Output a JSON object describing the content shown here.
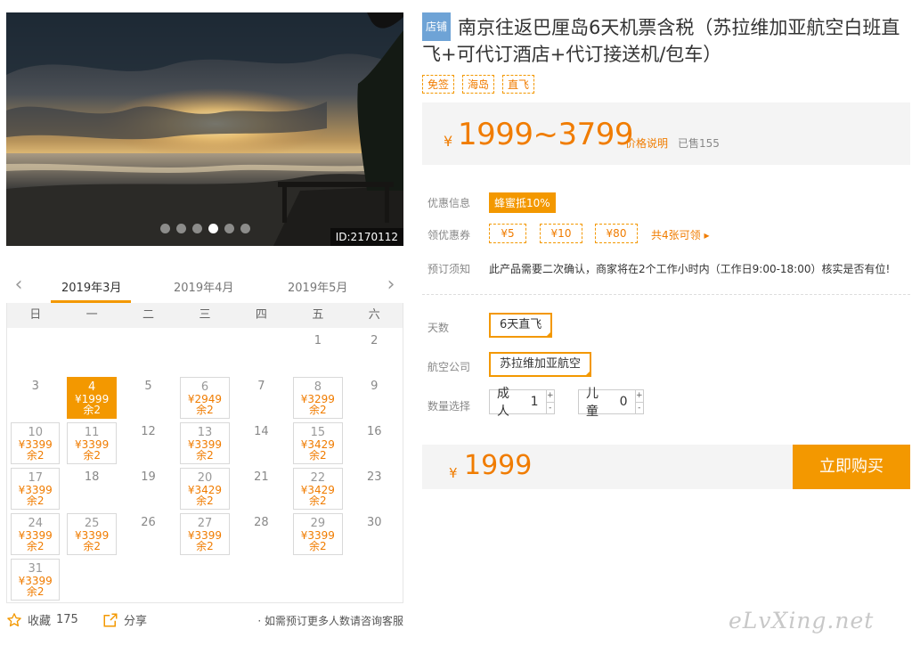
{
  "gallery": {
    "photo_id": "ID:2170112",
    "dot_count": 6,
    "active_dot": 3
  },
  "calendar": {
    "months": [
      "2019年3月",
      "2019年4月",
      "2019年5月"
    ],
    "active_month": 0,
    "weekdays": [
      "日",
      "一",
      "二",
      "三",
      "四",
      "五",
      "六"
    ],
    "days": [
      {
        "d": ""
      },
      {
        "d": ""
      },
      {
        "d": ""
      },
      {
        "d": ""
      },
      {
        "d": ""
      },
      {
        "d": "1"
      },
      {
        "d": "2"
      },
      {
        "d": "3"
      },
      {
        "d": "4",
        "price": "¥1999",
        "left": "余2",
        "selected": true
      },
      {
        "d": "5"
      },
      {
        "d": "6",
        "price": "¥2949",
        "left": "余2"
      },
      {
        "d": "7"
      },
      {
        "d": "8",
        "price": "¥3299",
        "left": "余2"
      },
      {
        "d": "9"
      },
      {
        "d": "10",
        "price": "¥3399",
        "left": "余2"
      },
      {
        "d": "11",
        "price": "¥3399",
        "left": "余2"
      },
      {
        "d": "12"
      },
      {
        "d": "13",
        "price": "¥3399",
        "left": "余2"
      },
      {
        "d": "14"
      },
      {
        "d": "15",
        "price": "¥3429",
        "left": "余2"
      },
      {
        "d": "16"
      },
      {
        "d": "17",
        "price": "¥3399",
        "left": "余2"
      },
      {
        "d": "18"
      },
      {
        "d": "19"
      },
      {
        "d": "20",
        "price": "¥3429",
        "left": "余2"
      },
      {
        "d": "21"
      },
      {
        "d": "22",
        "price": "¥3429",
        "left": "余2"
      },
      {
        "d": "23"
      },
      {
        "d": "24",
        "price": "¥3399",
        "left": "余2"
      },
      {
        "d": "25",
        "price": "¥3399",
        "left": "余2"
      },
      {
        "d": "26"
      },
      {
        "d": "27",
        "price": "¥3399",
        "left": "余2"
      },
      {
        "d": "28"
      },
      {
        "d": "29",
        "price": "¥3399",
        "left": "余2"
      },
      {
        "d": "30"
      },
      {
        "d": "31",
        "price": "¥3399",
        "left": "余2"
      }
    ]
  },
  "actions": {
    "fav_label": "收藏",
    "fav_count": "175",
    "share_label": "分享",
    "consult_text": "· 如需预订更多人数请咨询客服"
  },
  "product": {
    "shop_tag": "店铺",
    "title": "南京往返巴厘岛6天机票含税（苏拉维加亚航空白班直飞+可代订酒店+代订接送机/包车）",
    "tags": [
      "免签",
      "海岛",
      "直飞"
    ],
    "currency": "¥",
    "price_range": "1999~3799",
    "price_explain": "价格说明",
    "sold": "已售155"
  },
  "promo": {
    "discount_label": "优惠信息",
    "discount_badge": "蜂蜜抵10%",
    "coupon_label": "领优惠券",
    "coupons": [
      "¥5",
      "¥10",
      "¥80"
    ],
    "coupon_link": "共4张可领 ▸",
    "notice_label": "预订须知",
    "notice_text": "此产品需要二次确认，商家将在2个工作小时内（工作日9:00-18:00）核实是否有位!"
  },
  "options": {
    "days_label": "天数",
    "days_value": "6天直飞",
    "airline_label": "航空公司",
    "airline_value": "苏拉维加亚航空",
    "qty_label": "数量选择",
    "adult_label": "成人",
    "adult_value": "1",
    "child_label": "儿童",
    "child_value": "0",
    "plus": "+",
    "minus": "-"
  },
  "buy": {
    "currency": "¥",
    "total": "1999",
    "button": "立即购买"
  },
  "watermark": "eLvXing.net",
  "colors": {
    "accent": "#f39800",
    "accent_text": "#f07c00",
    "shop_tag_bg": "#6ea3d6"
  }
}
